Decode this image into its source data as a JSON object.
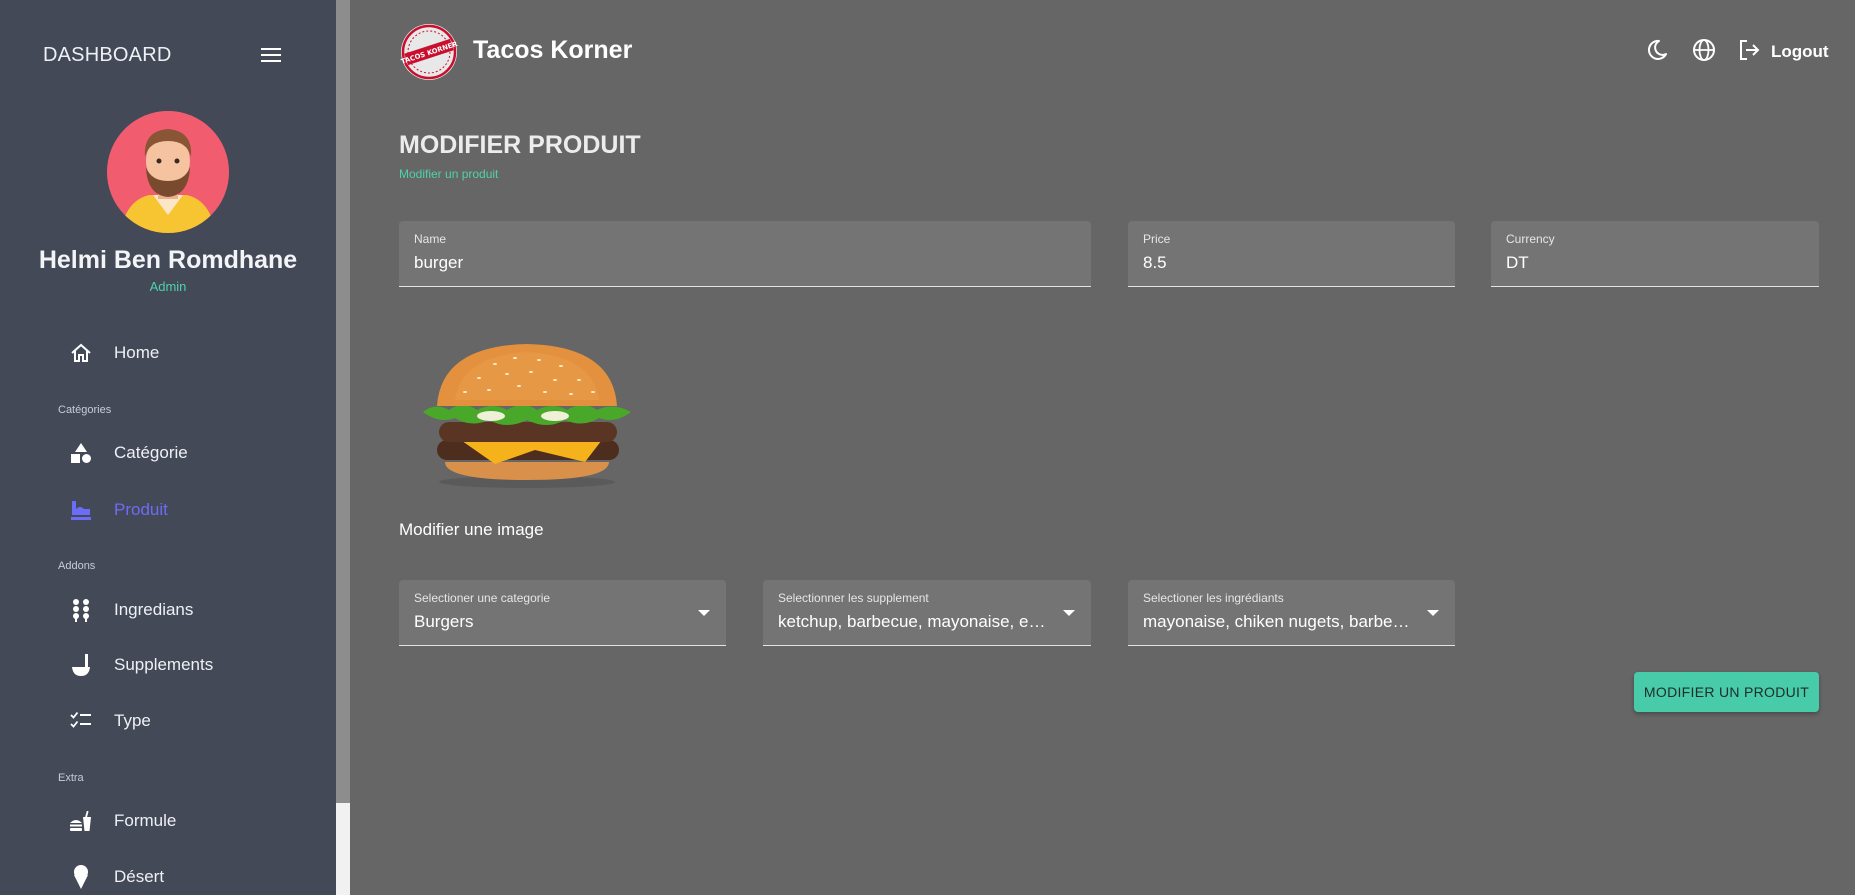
{
  "sidebar": {
    "title": "DASHBOARD",
    "user_name": "Helmi Ben Romdhane",
    "user_role": "Admin",
    "items": [
      {
        "label": "Home",
        "icon": "home-icon"
      },
      {
        "label": "Catégorie",
        "icon": "shapes-icon"
      },
      {
        "label": "Produit",
        "icon": "product-icon",
        "active": true
      },
      {
        "label": "Ingredians",
        "icon": "ingredients-icon"
      },
      {
        "label": "Supplements",
        "icon": "ladle-icon"
      },
      {
        "label": "Type",
        "icon": "checklist-icon"
      },
      {
        "label": "Formule",
        "icon": "fastfood-icon"
      },
      {
        "label": "Désert",
        "icon": "icecream-icon"
      }
    ],
    "sections": {
      "categories": "Catégories",
      "addons": "Addons",
      "extra": "Extra"
    }
  },
  "header": {
    "app_name": "Tacos Korner",
    "logo_text": "TACOS KORNER",
    "logout_label": "Logout"
  },
  "page": {
    "title": "MODIFIER PRODUIT",
    "subtitle": "Modifier un produit"
  },
  "form": {
    "name": {
      "label": "Name",
      "value": "burger"
    },
    "price": {
      "label": "Price",
      "value": "8.5"
    },
    "currency": {
      "label": "Currency",
      "value": "DT"
    },
    "image_link": "Modifier une image",
    "category": {
      "label": "Selectioner une categorie",
      "value": "Burgers"
    },
    "supplements": {
      "label": "Selectionner les supplement",
      "value": "ketchup, barbecue, mayonaise, escalope"
    },
    "ingredients": {
      "label": "Selectioner les ingrédiants",
      "value": "mayonaise, chiken nugets, barbecue, ketchup"
    },
    "submit_label": "MODIFIER UN PRODUIT"
  },
  "colors": {
    "accent": "#47cba9",
    "active_nav": "#6c6cf6",
    "sidebar_bg": "#434957",
    "content_bg": "#666666"
  }
}
